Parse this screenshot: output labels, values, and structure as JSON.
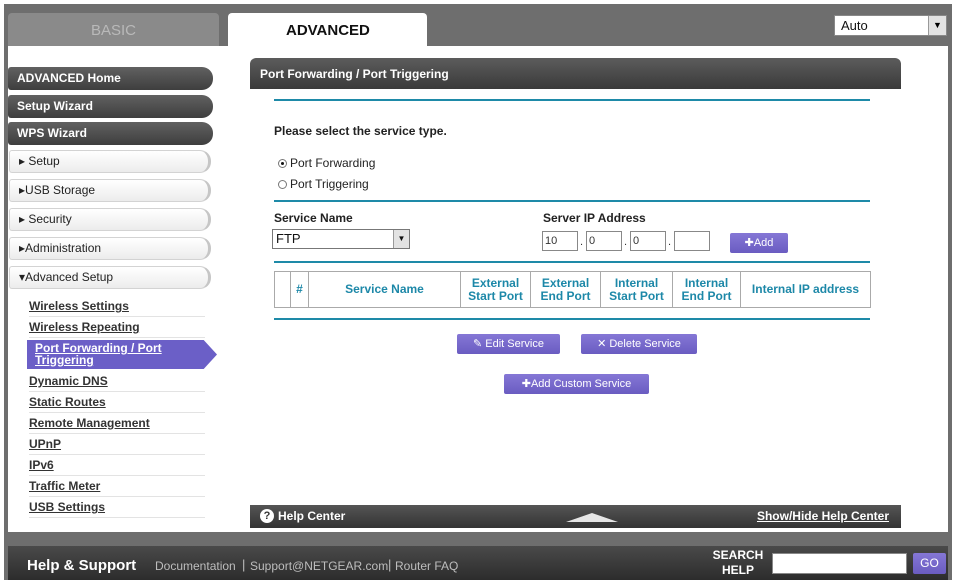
{
  "tabs": {
    "basic": "BASIC",
    "advanced": "ADVANCED"
  },
  "language": {
    "value": "Auto"
  },
  "sidebar": {
    "advanced_home": "ADVANCED Home",
    "setup_wizard": "Setup Wizard",
    "wps_wizard": "WPS Wizard",
    "setup": "▸ Setup",
    "usb_storage": "▸USB Storage",
    "security": "▸ Security",
    "administration": "▸Administration",
    "advanced_setup": "▾Advanced Setup",
    "sub": [
      "Wireless Settings",
      "Wireless Repeating",
      "Port Forwarding / Port Triggering",
      "Dynamic DNS",
      "Static Routes",
      "Remote Management",
      "UPnP",
      "IPv6",
      "Traffic Meter",
      "USB Settings"
    ]
  },
  "panel": {
    "title": "Port Forwarding / Port Triggering",
    "prompt": "Please select the service type.",
    "radio_forwarding": "Port Forwarding",
    "radio_triggering": "Port Triggering",
    "selected_type": "Port Forwarding",
    "service_name_label": "Service Name",
    "service_name_value": "FTP",
    "server_ip_label": "Server IP Address",
    "ip": [
      "10",
      "0",
      "0",
      ""
    ],
    "add_button": "Add",
    "table_headers": [
      "",
      "#",
      "Service Name",
      "External Start Port",
      "External End Port",
      "Internal Start Port",
      "Internal End Port",
      "Internal IP address"
    ],
    "edit_button": "Edit Service",
    "delete_button": "Delete Service",
    "add_custom_button": "Add Custom Service",
    "help_center": "Help Center",
    "show_hide_help": "Show/Hide Help Center"
  },
  "footer": {
    "help_support": "Help & Support",
    "documentation": "Documentation",
    "support_email": "Support@NETGEAR.com",
    "router_faq": "Router FAQ",
    "search_label": "SEARCH HELP",
    "search_value": "",
    "go": "GO"
  }
}
